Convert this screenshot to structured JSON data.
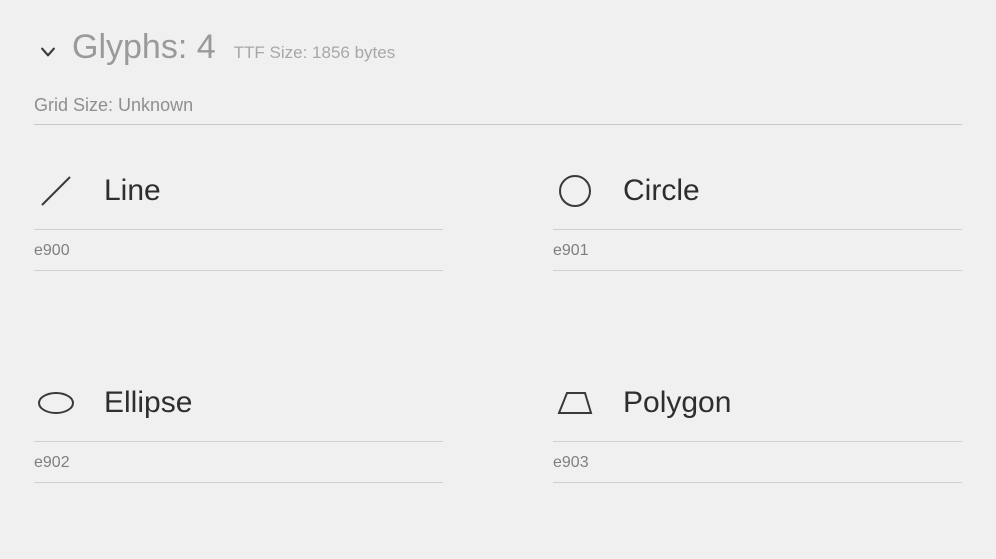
{
  "header": {
    "title_prefix": "Glyphs:",
    "glyph_count": "4",
    "ttf_size_label": "TTF Size: 1856 bytes"
  },
  "gridsize": {
    "label": "Grid Size:",
    "value": "Unknown"
  },
  "glyphs": [
    {
      "name": "Line",
      "code": "e900",
      "icon": "line-icon"
    },
    {
      "name": "Circle",
      "code": "e901",
      "icon": "circle-icon"
    },
    {
      "name": "Ellipse",
      "code": "e902",
      "icon": "ellipse-icon"
    },
    {
      "name": "Polygon",
      "code": "e903",
      "icon": "polygon-icon"
    }
  ]
}
